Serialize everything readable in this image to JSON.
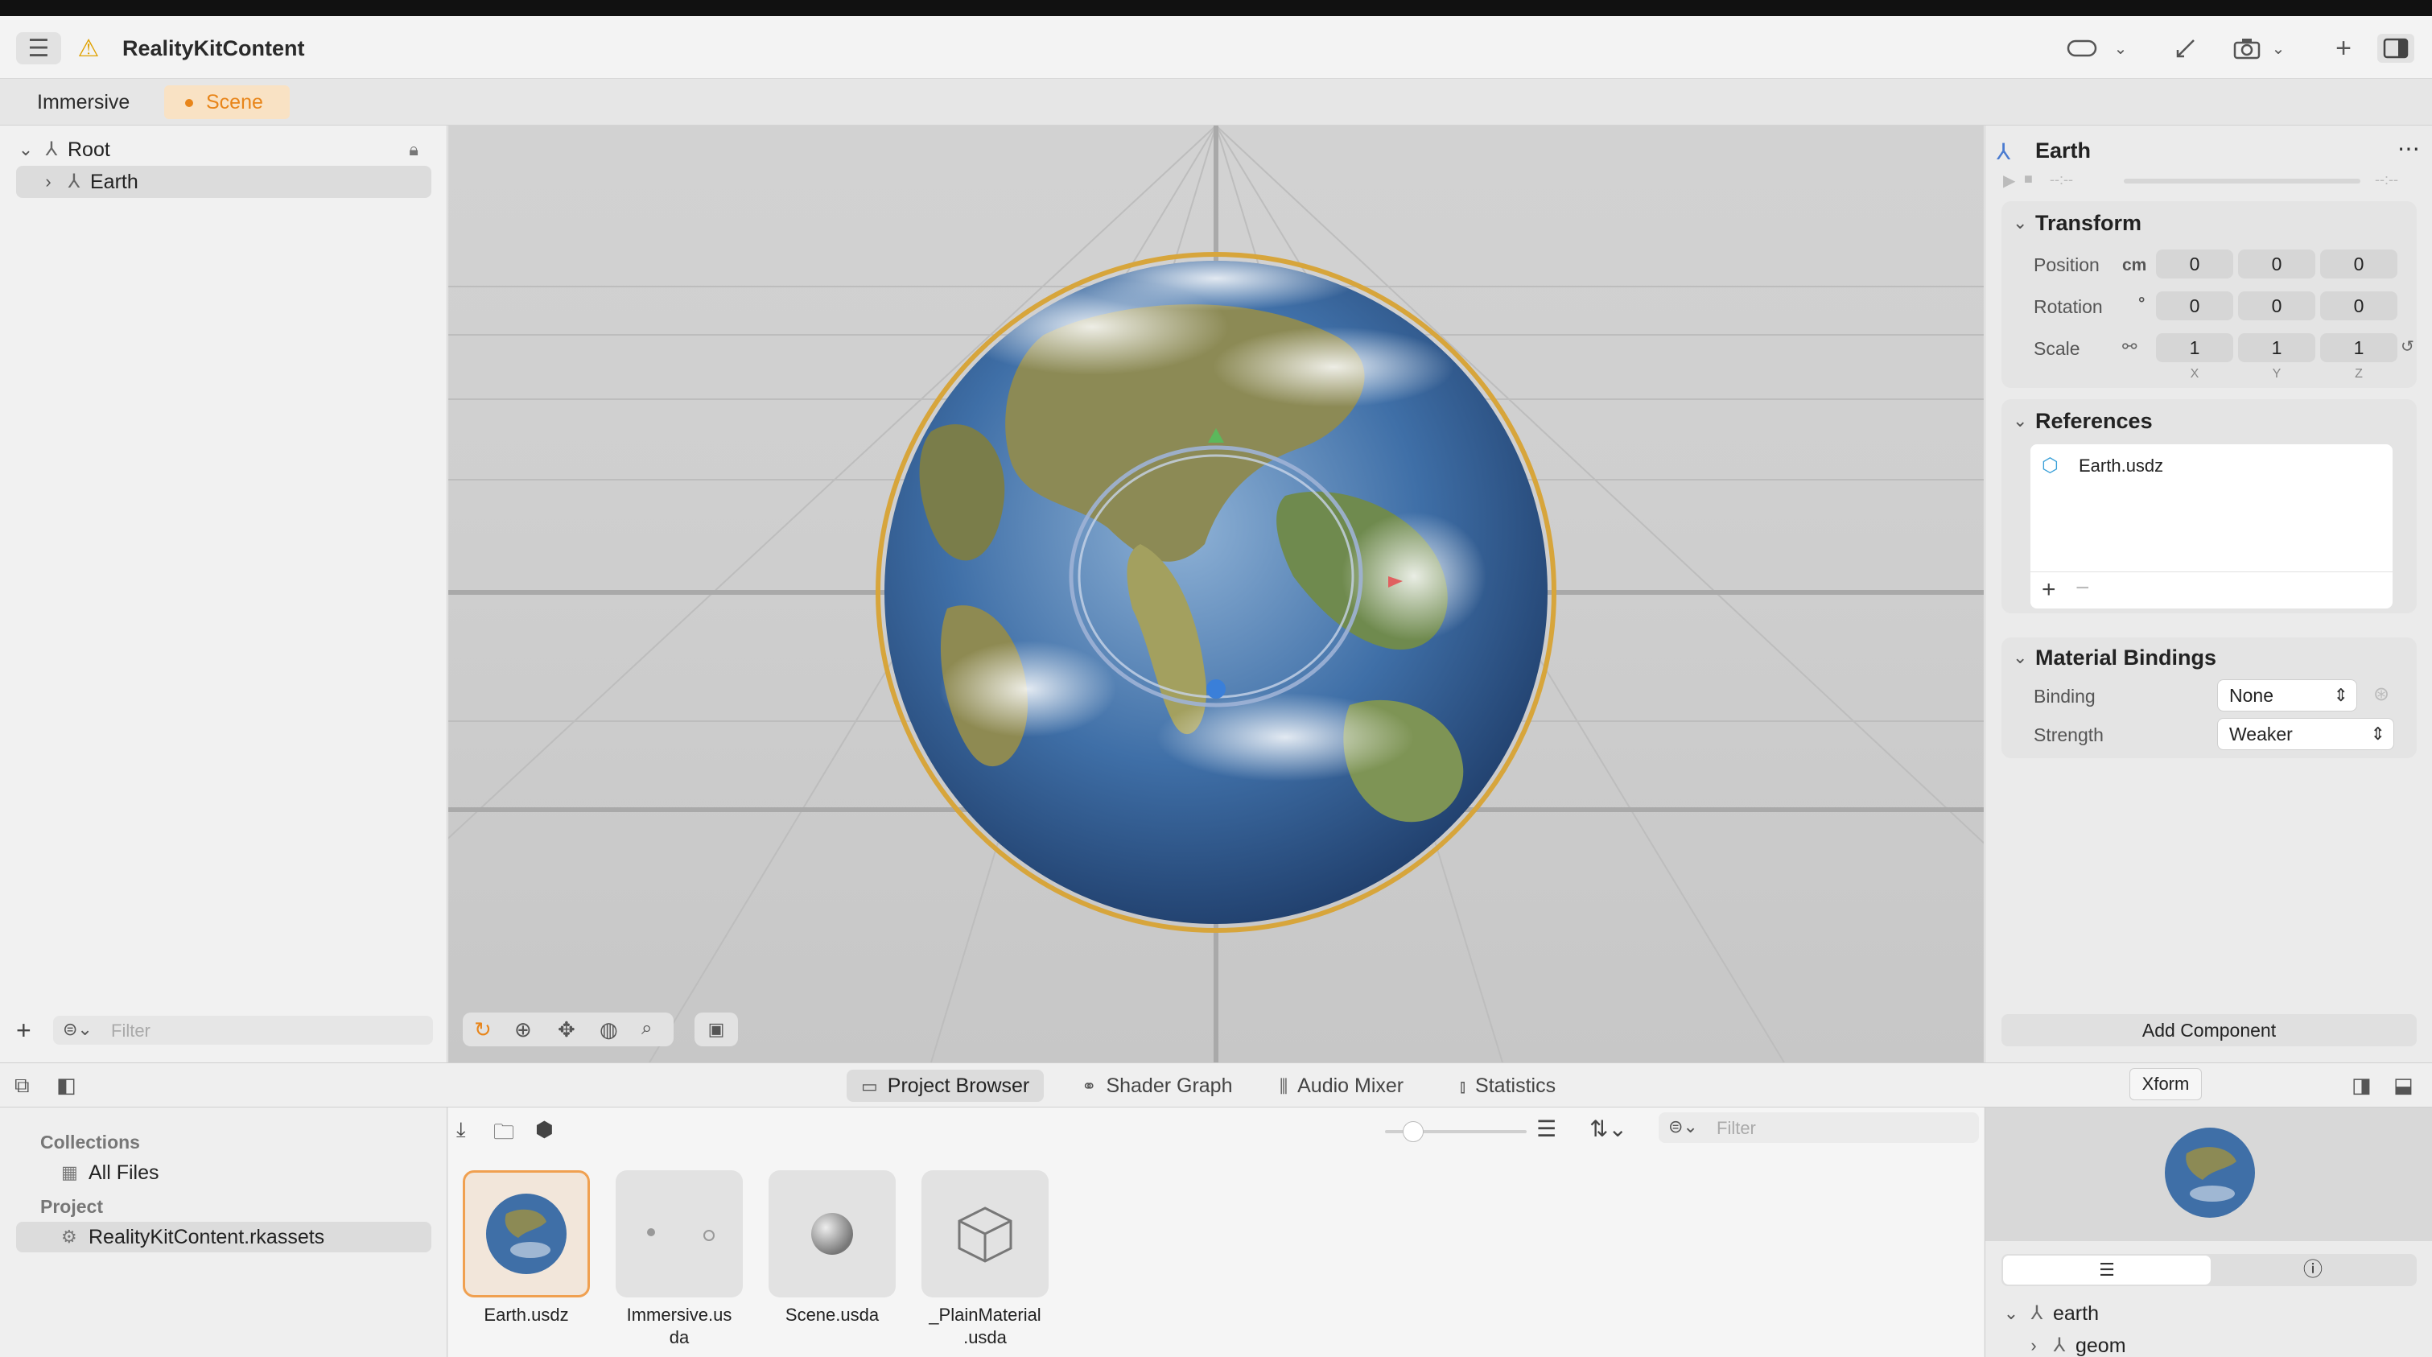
{
  "app": {
    "title": "RealityKitContent",
    "warning_icon": "warning-icon"
  },
  "tabs": [
    {
      "label": "Immersive",
      "active": false
    },
    {
      "label": "Scene",
      "active": true
    }
  ],
  "hierarchy": {
    "root": "Root",
    "child": "Earth",
    "filter_placeholder": "Filter"
  },
  "inspector": {
    "entity_name": "Earth",
    "timeline_start": "--:--",
    "timeline_end": "--:--",
    "transform": {
      "title": "Transform",
      "position_label": "Position",
      "position_unit": "cm",
      "position": [
        "0",
        "0",
        "0"
      ],
      "rotation_label": "Rotation",
      "rotation_unit": "°",
      "rotation": [
        "0",
        "0",
        "0"
      ],
      "scale_label": "Scale",
      "scale": [
        "1",
        "1",
        "1"
      ],
      "axes": [
        "X",
        "Y",
        "Z"
      ]
    },
    "references": {
      "title": "References",
      "items": [
        "Earth.usdz"
      ]
    },
    "material_bindings": {
      "title": "Material Bindings",
      "binding_label": "Binding",
      "binding_value": "None",
      "strength_label": "Strength",
      "strength_value": "Weaker"
    },
    "add_component": "Add Component"
  },
  "bottom_tabs": [
    {
      "label": "Project Browser",
      "icon": "folder-icon",
      "active": true
    },
    {
      "label": "Shader Graph",
      "icon": "nodes-icon",
      "active": false
    },
    {
      "label": "Audio Mixer",
      "icon": "sliders-icon",
      "active": false
    },
    {
      "label": "Statistics",
      "icon": "chart-icon",
      "active": false
    }
  ],
  "tooltip": "Xform",
  "collections": {
    "header": "Collections",
    "all_files": "All Files",
    "project_header": "Project",
    "project_item": "RealityKitContent.rkassets"
  },
  "browser": {
    "filter_placeholder": "Filter",
    "assets": [
      {
        "name": "Earth.usdz",
        "selected": true
      },
      {
        "name": "Immersive.us\nda",
        "selected": false
      },
      {
        "name": "Scene.usda",
        "selected": false
      },
      {
        "name": "_PlainMaterial\n.usda",
        "selected": false
      }
    ]
  },
  "preview": {
    "tree_root": "earth",
    "tree_child": "geom"
  },
  "colors": {
    "accent_orange": "#e8851a",
    "selection_ring": "#d7a53b"
  }
}
